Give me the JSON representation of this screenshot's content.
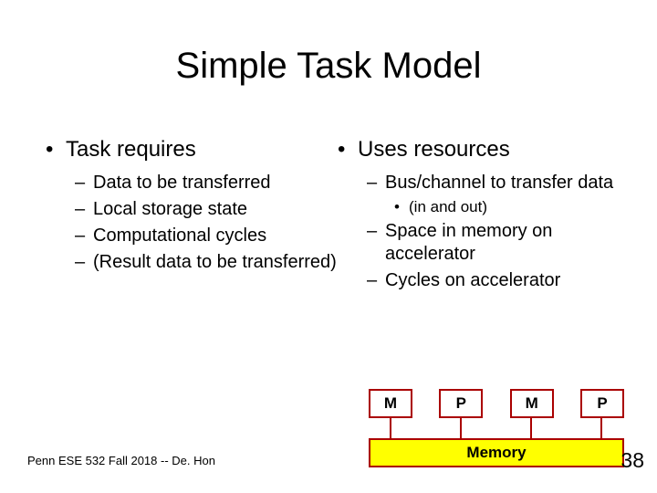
{
  "title": "Simple Task Model",
  "left": {
    "heading": "Task requires",
    "items": [
      "Data to be transferred",
      "Local storage state",
      "Computational cycles",
      "(Result data to be transferred)"
    ]
  },
  "right": {
    "heading": "Uses resources",
    "item1": "Bus/channel to transfer data",
    "item1_sub": "(in and out)",
    "item2": "Space in memory on accelerator",
    "item3": "Cycles on accelerator"
  },
  "diagram": {
    "blocks": [
      "M",
      "P",
      "M",
      "P"
    ],
    "memory": "Memory"
  },
  "footer": "Penn ESE 532 Fall 2018 -- De. Hon",
  "page": "38"
}
